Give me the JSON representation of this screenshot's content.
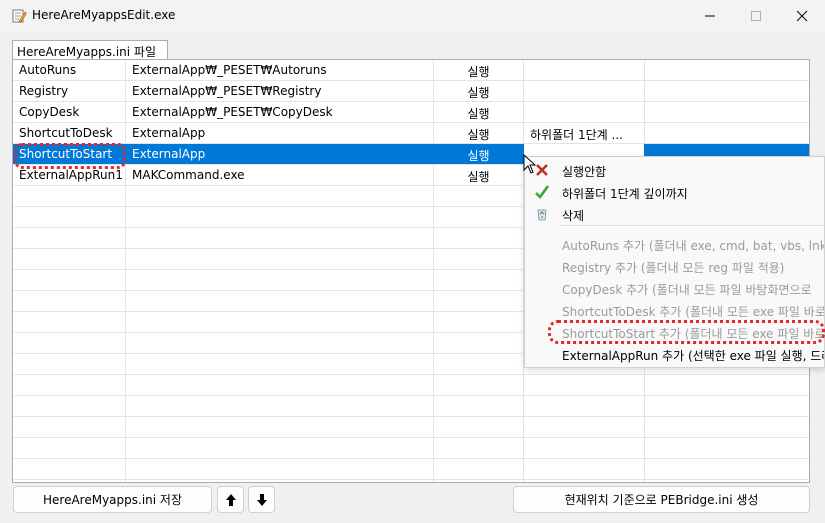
{
  "window": {
    "title": "HereAreMyappsEdit.exe"
  },
  "group_label": "HereAreMyapps.ini 파일",
  "rows": [
    {
      "name": "AutoRuns",
      "path": "ExternalApp₩_PESET₩Autoruns",
      "action": "실행",
      "option": "",
      "extra": ""
    },
    {
      "name": "Registry",
      "path": "ExternalApp₩_PESET₩Registry",
      "action": "실행",
      "option": "",
      "extra": ""
    },
    {
      "name": "CopyDesk",
      "path": "ExternalApp₩_PESET₩CopyDesk",
      "action": "실행",
      "option": "",
      "extra": ""
    },
    {
      "name": "ShortcutToDesk",
      "path": "ExternalApp",
      "action": "실행",
      "option": "하위폴더 1단계 ...",
      "extra": ""
    },
    {
      "name": "ShortcutToStart",
      "path": "ExternalApp",
      "action": "실행",
      "option": "",
      "extra": ""
    },
    {
      "name": "ExternalAppRun1",
      "path": "MAKCommand.exe",
      "action": "실행",
      "option": "",
      "extra": ""
    }
  ],
  "selected_row": 4,
  "context_menu": {
    "items": [
      {
        "label": "실행안함",
        "icon": "red-x-icon",
        "disabled": false
      },
      {
        "label": "하위폴더 1단계 깊이까지",
        "icon": "green-check-icon",
        "disabled": false
      },
      {
        "label": "삭제",
        "icon": "recycle-bin-icon",
        "disabled": false
      },
      {
        "label": "AutoRuns 추가 (폴더내 exe, cmd, bat, vbs, lnk 모",
        "disabled": true
      },
      {
        "label": "Registry 추가 (폴더내 모든 reg 파일 적용)",
        "disabled": true
      },
      {
        "label": "CopyDesk 추가 (폴더내 모든 파일 바탕화면으로",
        "disabled": true
      },
      {
        "label": "ShortcutToDesk 추가 (폴더내 모든 exe 파일 바로",
        "disabled": true
      },
      {
        "label": "ShortcutToStart 추가 (폴더내 모든 exe 파일 바로",
        "disabled": true
      },
      {
        "label": "ExternalAppRun 추가 (선택한 exe 파일 실행, 드라",
        "disabled": false
      }
    ]
  },
  "buttons": {
    "save": "HereAreMyapps.ini 저장",
    "up": "🡅",
    "down": "🡇",
    "generate": "현재위치 기준으로 PEBridge.ini 생성"
  },
  "colors": {
    "selection": "#0078d7",
    "highlight_outline": "#e0282a"
  }
}
